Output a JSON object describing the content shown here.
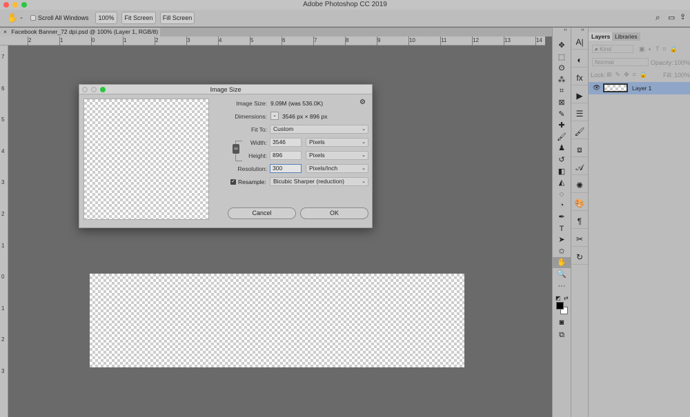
{
  "app_title": "Adobe Photoshop CC 2019",
  "traffic_colors": {
    "close": "#fe5f57",
    "minimize": "#febc2e",
    "zoom": "#28c840"
  },
  "options_bar": {
    "tool_icon": "hand-icon",
    "scroll_all_label": "Scroll All Windows",
    "scroll_all_checked": false,
    "btn_100": "100%",
    "btn_fit": "Fit Screen",
    "btn_fill": "Fill Screen"
  },
  "document_tab": {
    "close": "×",
    "title": "Facebook Banner_72 dpi.psd @ 100% (Layer 1, RGB/8)"
  },
  "rulers": {
    "horizontal": [
      "2",
      "1",
      "0",
      "1",
      "2",
      "3",
      "4",
      "5",
      "6",
      "7",
      "8",
      "9",
      "10",
      "11",
      "12",
      "13",
      "14"
    ],
    "vertical": [
      "7",
      "6",
      "5",
      "4",
      "3",
      "2",
      "1",
      "0",
      "1",
      "2",
      "3"
    ]
  },
  "dialog": {
    "title": "Image Size",
    "image_size_label": "Image Size:",
    "image_size_value": "9.09M (was 536.0K)",
    "dimensions_label": "Dimensions:",
    "dimensions_value": "3546 px  ×  896 px",
    "fit_to_label": "Fit To:",
    "fit_to_value": "Custom",
    "width_label": "Width:",
    "width_value": "3546",
    "width_unit": "Pixels",
    "height_label": "Height:",
    "height_value": "896",
    "height_unit": "Pixels",
    "resolution_label": "Resolution:",
    "resolution_value": "300",
    "resolution_unit": "Pixels/Inch",
    "resample_label": "Resample:",
    "resample_checked": true,
    "resample_value": "Bicubic Sharper (reduction)",
    "cancel": "Cancel",
    "ok": "OK"
  },
  "layers_panel": {
    "tabs": [
      "Layers",
      "Libraries"
    ],
    "filter_placeholder": "Kind",
    "blend_mode": "Normal",
    "opacity_label": "Opacity:",
    "opacity_value": "100%",
    "lock_label": "Lock:",
    "fill_label": "Fill:",
    "fill_value": "100%",
    "layers": [
      {
        "name": "Layer 1",
        "visible": true,
        "selected": true
      }
    ],
    "selected_color": "#8fa6c9"
  },
  "collapse_glyph": "‹‹"
}
